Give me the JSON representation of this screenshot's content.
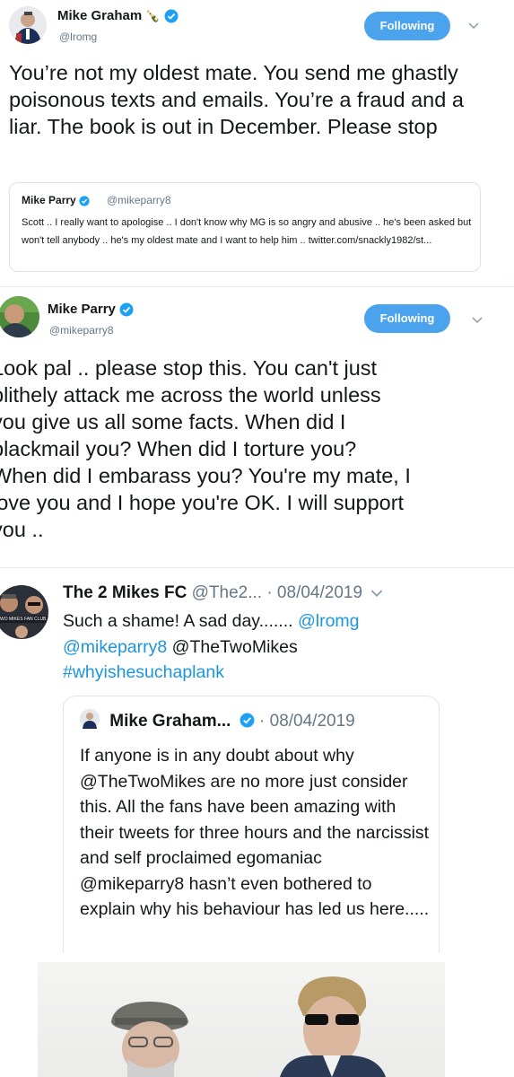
{
  "tweet1": {
    "name": "Mike Graham",
    "emoji": "🍾",
    "handle": "@lromg",
    "follow_label": "Following",
    "text": "You’re not my oldest mate. You send me ghastly poisonous texts and emails. You’re a fraud and a liar. The book is out in December. Please stop",
    "quote": {
      "name": "Mike Parry",
      "handle": "@mikeparry8",
      "text": "Scott .. I really want to apologise .. I don't know why MG is so angry and abusive .. he's been asked but won't tell anybody .. he's my oldest mate and I want to help him .. twitter.com/snackly1982/st..."
    }
  },
  "tweet2": {
    "name": "Mike Parry",
    "handle": "@mikeparry8",
    "follow_label": "Following",
    "lines": [
      "Look pal .. please stop this. You can't just",
      "blithely attack me across the world unless",
      "you give us all some facts. When did I",
      "blackmail you? When did I torture you?",
      "When did I embarass you? You're my mate, I",
      "love you and I hope you're OK. I will support",
      "you .."
    ]
  },
  "tweet3": {
    "name": "The 2 Mikes FC",
    "handle": "@The2...",
    "date": "· 08/04/2019",
    "avatar_text": "WO MIKES FAN CLUB",
    "text_start": "Such a shame!  A sad day....... ",
    "mention1": "@lromg",
    "mention2": "@mikeparry8",
    "mention3": "@TheTwoMikes",
    "hashtag": "#whyishesuchaplank",
    "quote": {
      "name": "Mike Graham...",
      "date": "· 08/04/2019",
      "text": "If anyone is in any doubt about why @TheTwoMikes are no more just consider this. All the fans have been amazing with their tweets for three hours and the narcissist and self proclaimed egomaniac @mikeparry8 hasn’t even bothered to explain why his behaviour has led us here....."
    }
  },
  "colors": {
    "follow_button": "#4aa3ec",
    "link": "#1b95e0",
    "verified": "#1da1f2",
    "secondary_text": "#657786"
  }
}
